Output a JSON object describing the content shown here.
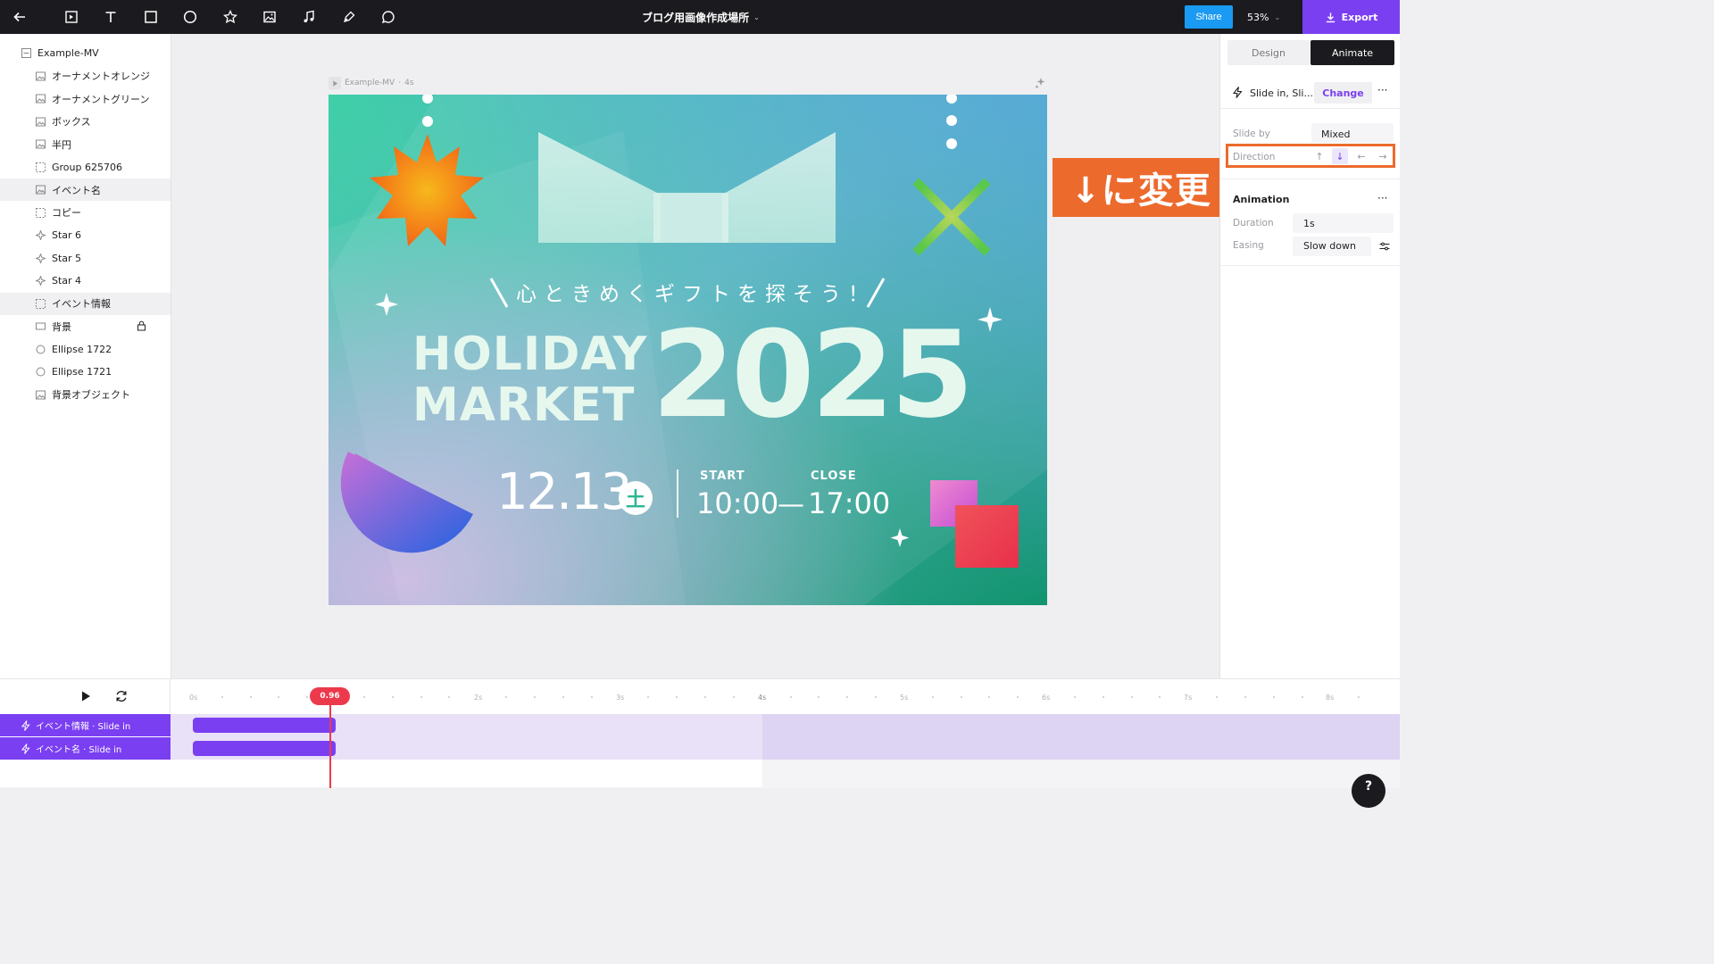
{
  "toolbar": {
    "title": "ブログ用画像作成場所",
    "share": "Share",
    "zoom": "53%",
    "export": "Export"
  },
  "layers": [
    {
      "label": "Example-MV",
      "icon": "frame-icon"
    },
    {
      "label": "オーナメントオレンジ",
      "icon": "image-icon"
    },
    {
      "label": "オーナメントグリーン",
      "icon": "image-icon"
    },
    {
      "label": "ボックス",
      "icon": "image-icon"
    },
    {
      "label": "半円",
      "icon": "image-icon"
    },
    {
      "label": "Group 625706",
      "icon": "group-icon"
    },
    {
      "label": "イベント名",
      "icon": "image-icon"
    },
    {
      "label": "コピー",
      "icon": "group-icon"
    },
    {
      "label": "Star 6",
      "icon": "star-icon"
    },
    {
      "label": "Star 5",
      "icon": "star-icon"
    },
    {
      "label": "Star 4",
      "icon": "star-icon"
    },
    {
      "label": "イベント情報",
      "icon": "group-icon"
    },
    {
      "label": "背景",
      "icon": "rect-icon"
    },
    {
      "label": "Ellipse 1722",
      "icon": "ellipse-icon"
    },
    {
      "label": "Ellipse 1721",
      "icon": "ellipse-icon"
    },
    {
      "label": "背景オブジェクト",
      "icon": "image-icon"
    }
  ],
  "canvas": {
    "frame_name": "Example-MV",
    "frame_duration": "4s"
  },
  "artboard": {
    "tagline": "心ときめくギフトを探そう！",
    "event_line1": "HOLIDAY",
    "event_line2": "MARKET",
    "year": "2025",
    "date": "12.13",
    "weekday": "土",
    "start_label": "START",
    "start_time": "10:00",
    "dash": "—",
    "close_label": "CLOSE",
    "close_time": "17:00"
  },
  "callout": "↓に変更",
  "panel": {
    "tab_design": "Design",
    "tab_animate": "Animate",
    "effect": "Slide in, Sli...",
    "change": "Change",
    "slide_by_label": "Slide by",
    "slide_by_value": "Mixed",
    "direction_label": "Direction",
    "direction_up": "↑",
    "direction_down": "↓",
    "direction_left": "←",
    "direction_right": "→",
    "animation_label": "Animation",
    "duration_label": "Duration",
    "duration_value": "1s",
    "easing_label": "Easing",
    "easing_value": "Slow down"
  },
  "timeline": {
    "playhead": "0.96",
    "ticks": [
      "0s",
      "2s",
      "3s",
      "4s",
      "5s",
      "6s",
      "7s",
      "8s"
    ],
    "rows": [
      "イベント情報 · Slide in",
      "イベント名 · Slide in"
    ]
  },
  "colors": {
    "accent": "#7b3ff2",
    "share": "#1a9af2",
    "callout": "#ec6a2c",
    "playhead": "#ec3a4c"
  }
}
